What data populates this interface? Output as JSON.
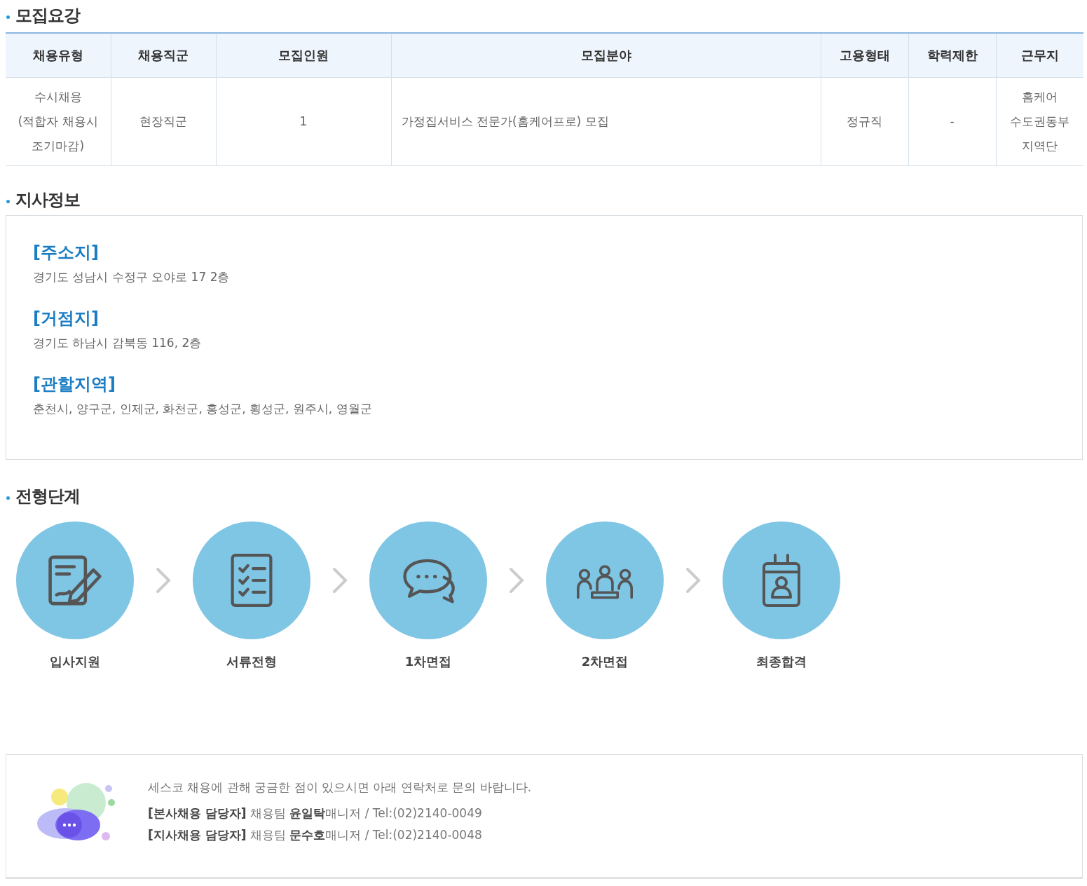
{
  "recruitment": {
    "title": "모집요강",
    "table": {
      "columns": [
        "채용유형",
        "채용직군",
        "모집인원",
        "모집분야",
        "고용형태",
        "학력제한",
        "근무지"
      ],
      "rows": [
        {
          "cells": [
            [
              "수시채용",
              "(적합자 채용시",
              "조기마감)"
            ],
            [
              "현장직군"
            ],
            [
              "1"
            ],
            [
              "가정집서비스 전문가(홈케어프로) 모집"
            ],
            [
              "정규직"
            ],
            [
              "-"
            ],
            [
              "홈케어",
              "수도권동부",
              "지역단"
            ]
          ]
        }
      ]
    }
  },
  "branch": {
    "title": "지사정보",
    "entries": [
      {
        "heading": "[주소지]",
        "text": "경기도 성남시 수정구 오야로 17 2층"
      },
      {
        "heading": "[거점지]",
        "text": "경기도 하남시 감북동 116, 2층"
      },
      {
        "heading": "[관할지역]",
        "text": "춘천시, 양구군, 인제군, 화천군, 홍성군, 횡성군, 원주시, 영월군"
      }
    ]
  },
  "process": {
    "title": "전형단계",
    "steps": [
      {
        "kind": "application",
        "label": "입사지원"
      },
      {
        "kind": "documents",
        "label": "서류전형"
      },
      {
        "kind": "chat",
        "label": "1차면접"
      },
      {
        "kind": "meeting",
        "label": "2차면접"
      },
      {
        "kind": "badge",
        "label": "최종합격"
      }
    ]
  },
  "contact": {
    "intro": "세스코 채용에 관해 궁금한 점이 있으시면 아래 연락처로 문의 바랍니다.",
    "lines": [
      "**[본사채용 담당자]** 채용팀 **윤일탁**매니저 / Tel:(02)2140-0049",
      "**[지사채용 담당자]** 채용팀 **문수호**매니저 / Tel:(02)2140-0048"
    ]
  }
}
